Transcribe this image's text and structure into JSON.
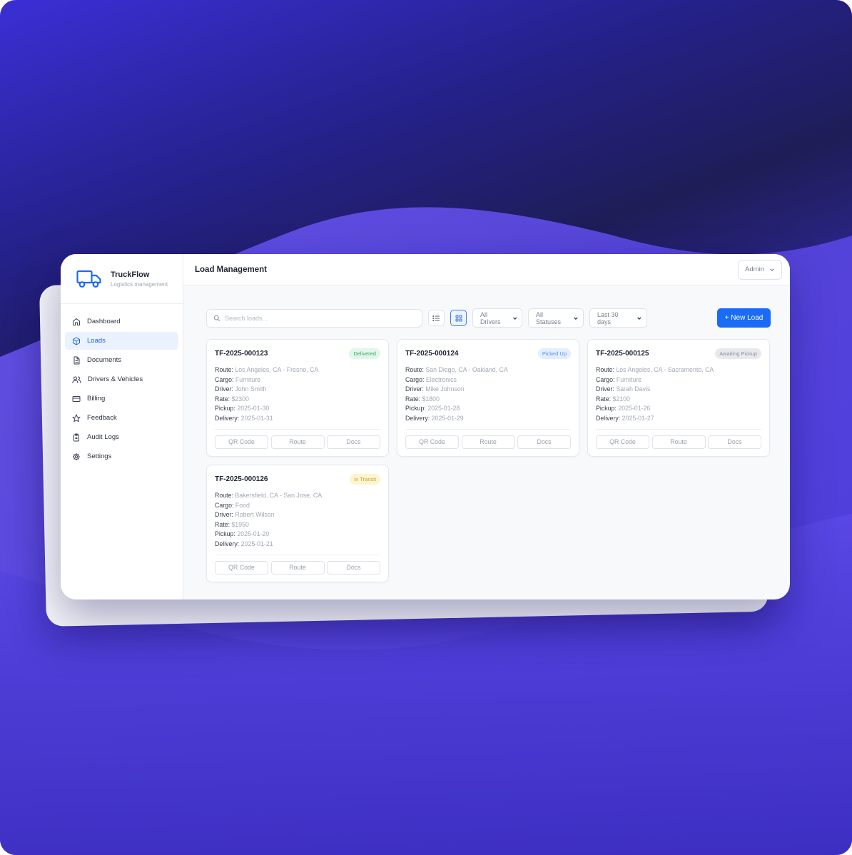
{
  "app": {
    "name": "TruckFlow",
    "tagline": "Logistics management"
  },
  "sidebar": {
    "items": [
      {
        "label": "Dashboard",
        "icon": "home-icon",
        "active": false
      },
      {
        "label": "Loads",
        "icon": "package-icon",
        "active": true
      },
      {
        "label": "Documents",
        "icon": "document-icon",
        "active": false
      },
      {
        "label": "Drivers & Vehicles",
        "icon": "users-icon",
        "active": false
      },
      {
        "label": "Billing",
        "icon": "credit-card-icon",
        "active": false
      },
      {
        "label": "Feedback",
        "icon": "star-icon",
        "active": false
      },
      {
        "label": "Audit Logs",
        "icon": "clipboard-icon",
        "active": false
      },
      {
        "label": "Settings",
        "icon": "gear-icon",
        "active": false
      }
    ]
  },
  "header": {
    "title": "Load Management",
    "user_menu": "Admin"
  },
  "toolbar": {
    "search_placeholder": "Search loads...",
    "drivers_filter": "All Drivers",
    "status_filter": "All Statuses",
    "date_filter": "Last 30 days",
    "new_load_label": "+ New Load",
    "view_mode": "grid"
  },
  "labels": {
    "route": "Route:",
    "cargo": "Cargo:",
    "driver": "Driver:",
    "rate": "Rate:",
    "pickup": "Pickup:",
    "delivery": "Delivery:",
    "qr_code": "QR Code",
    "route_btn": "Route",
    "docs": "Docs"
  },
  "loads": [
    {
      "id": "TF-2025-000123",
      "status": "Delivered",
      "status_color": "#3aa968",
      "route": "Los Angeles, CA - Fresno, CA",
      "cargo": "Furniture",
      "driver": "John Smith",
      "rate": "$2300",
      "pickup": "2025-01-30",
      "delivery": "2025-01-31"
    },
    {
      "id": "TF-2025-000124",
      "status": "Picked Up",
      "status_color": "#5b8fe8",
      "route": "San Diego, CA - Oakland, CA",
      "cargo": "Electronics",
      "driver": "Mike Johnson",
      "rate": "$1800",
      "pickup": "2025-01-28",
      "delivery": "2025-01-29"
    },
    {
      "id": "TF-2025-000125",
      "status": "Awaiting Pickup",
      "status_color": "#8a909c",
      "route": "Los Angeles, CA - Sacramento, CA",
      "cargo": "Furniture",
      "driver": "Sarah Davis",
      "rate": "$2100",
      "pickup": "2025-01-26",
      "delivery": "2025-01-27"
    },
    {
      "id": "TF-2025-000126",
      "status": "In Transit",
      "status_color": "#c9a232",
      "route": "Bakersfield, CA - San Jose, CA",
      "cargo": "Food",
      "driver": "Robert Wilson",
      "rate": "$1950",
      "pickup": "2025-01-20",
      "delivery": "2025-01-21"
    }
  ],
  "colors": {
    "accent": "#1a6bf5",
    "active_nav_bg": "#eaf2ff"
  }
}
